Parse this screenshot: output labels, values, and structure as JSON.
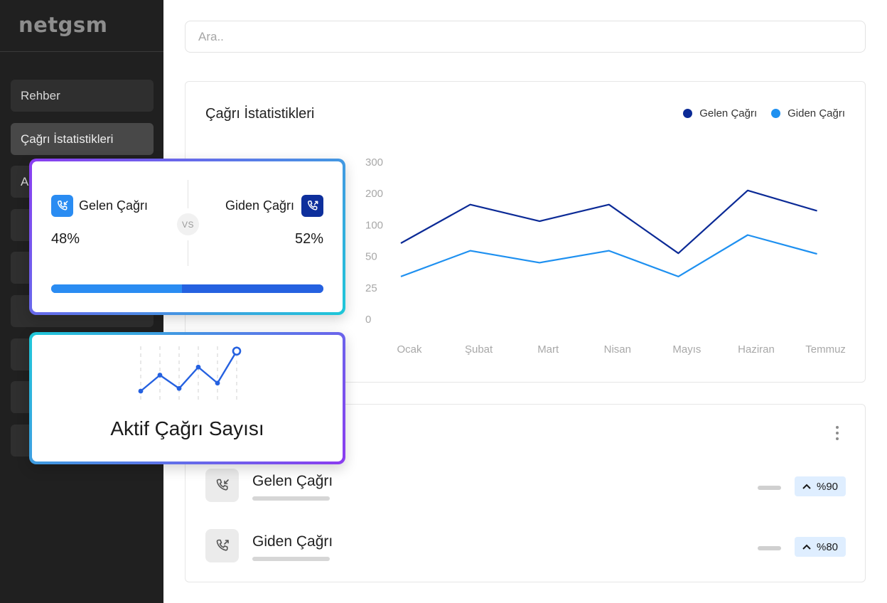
{
  "sidebar": {
    "logo": "netgsm",
    "items": [
      {
        "label": "Rehber"
      },
      {
        "label": "Çağrı İstatistikleri"
      },
      {
        "label": "A"
      },
      {
        "label": ""
      },
      {
        "label": ""
      },
      {
        "label": ""
      },
      {
        "label": ""
      },
      {
        "label": ""
      },
      {
        "label": ""
      }
    ]
  },
  "search": {
    "placeholder": "Ara.."
  },
  "stats_card": {
    "title": "Çağrı İstatistikleri",
    "legend": [
      {
        "label": "Gelen Çağrı",
        "color": "#0b2a96"
      },
      {
        "label": "Giden Çağrı",
        "color": "#1e90f0"
      }
    ]
  },
  "chart_data": {
    "type": "line",
    "title": "Çağrı İstatistikleri",
    "categories": [
      "Ocak",
      "Şubat",
      "Mart",
      "Nisan",
      "Mayıs",
      "Haziran",
      "Temmuz"
    ],
    "y_ticks": [
      "300",
      "200",
      "100",
      "50",
      "25",
      "0"
    ],
    "series": [
      {
        "name": "Gelen Çağrı",
        "color": "#0b2a96",
        "values": [
          71,
          165,
          112,
          165,
          55,
          210,
          145
        ]
      },
      {
        "name": "Giden Çağrı",
        "color": "#1e90f0",
        "values": [
          34,
          59,
          45,
          59,
          34,
          84,
          54
        ]
      }
    ],
    "legend": "top-right",
    "grid": false
  },
  "compare_card": {
    "incoming": {
      "label": "Gelen Çağrı",
      "percent_text": "48%",
      "share": 0.48,
      "color": "#2a8cf2"
    },
    "outgoing": {
      "label": "Giden Çağrı",
      "percent_text": "52%",
      "share": 0.52,
      "color": "#2561e0"
    },
    "vs": "VS"
  },
  "active_card": {
    "title": "Aktif Çağrı Sayısı",
    "sparkline": [
      2,
      5,
      2.5,
      6.5,
      3.5,
      9.5
    ],
    "color": "#2561e0"
  },
  "list_card": {
    "rows": [
      {
        "label": "Gelen Çağrı",
        "badge": "%90",
        "icon": "incoming-call-icon"
      },
      {
        "label": "Giden Çağrı",
        "badge": "%80",
        "icon": "outgoing-call-icon"
      }
    ]
  }
}
